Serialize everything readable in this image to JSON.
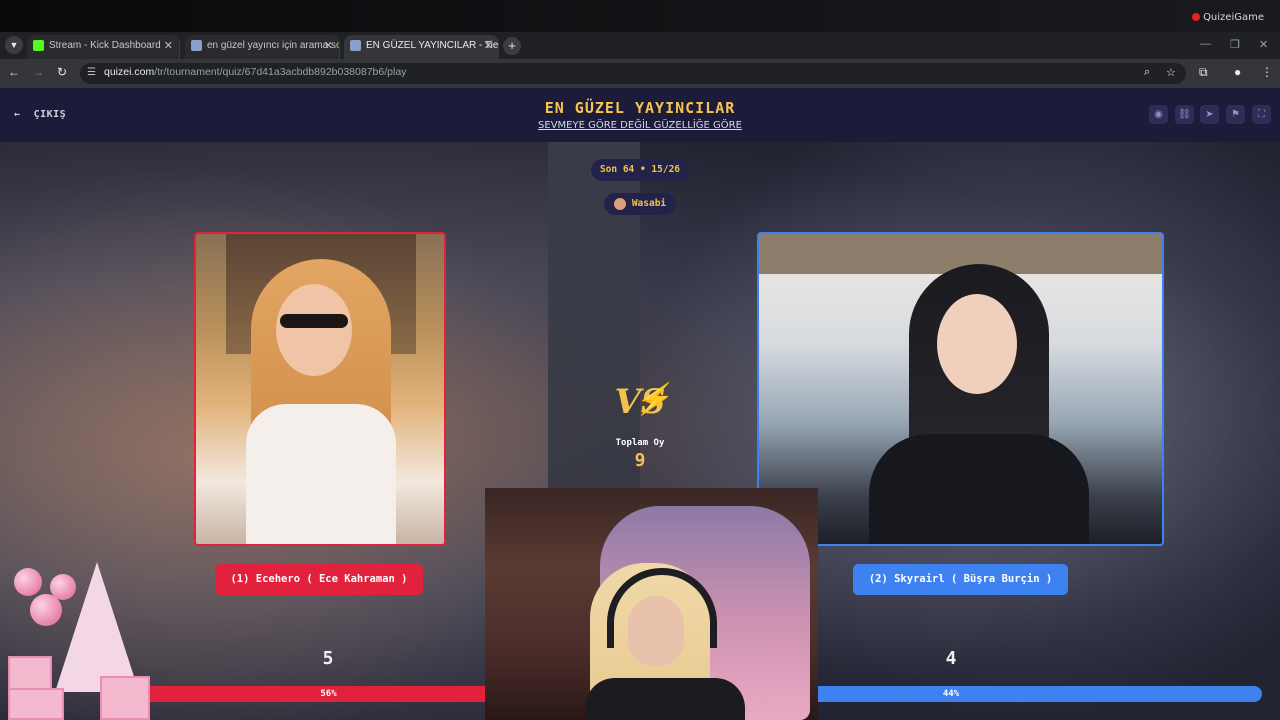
{
  "browser": {
    "tabs": [
      {
        "title": "Stream - Kick Dashboard",
        "favicon_color": "#53fc18",
        "active": false
      },
      {
        "title": "en güzel yayıncı için arama sonuçları",
        "favicon_color": "#f2c14e",
        "active": false
      },
      {
        "title": "EN GÜZEL YAYINCILAR - Tier List",
        "favicon_color": "#f2c14e",
        "active": true
      }
    ],
    "url_domain": "quizei.com",
    "url_path": "/tr/tournament/quiz/67d41a3acbdb892b038087b6/play",
    "watermark": "QuizeiGame"
  },
  "header": {
    "back_label": "ÇIKIŞ",
    "title": "EN GÜZEL YAYINCILAR",
    "subtitle": "SEVMEYE GÖRE DEĞİL GÜZELLİĞE GÖRE",
    "icons": [
      "eye-icon",
      "link-icon",
      "send-icon",
      "flag-icon",
      "fullscreen-icon"
    ]
  },
  "game": {
    "round": "Son 64 • 15/26",
    "host": "Wasabi",
    "total_label": "Toplam Oy",
    "total_votes": "9",
    "left": {
      "name": "(1) Ecehero ( Ece Kahraman )",
      "votes": "5",
      "percent_label": "56%",
      "percent": 56,
      "color": "#e2213d"
    },
    "right": {
      "name": "(2) Skyrairl ( Büşra Burçin )",
      "votes": "4",
      "percent_label": "44%",
      "percent": 44,
      "color": "#3d82f0"
    }
  }
}
